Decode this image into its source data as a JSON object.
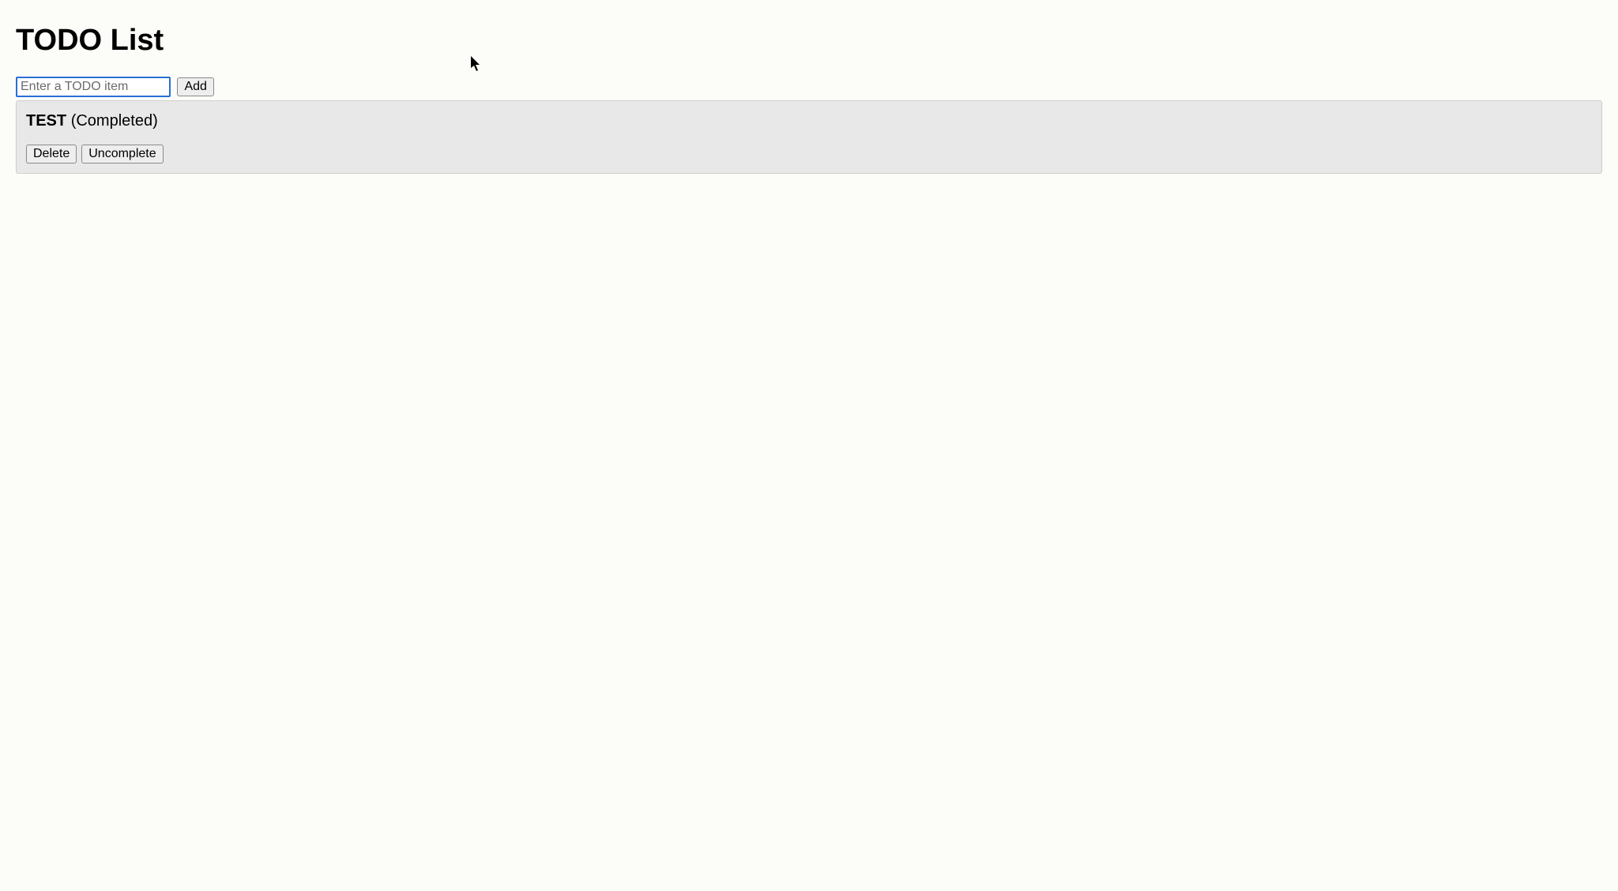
{
  "header": {
    "title": "TODO List"
  },
  "input": {
    "placeholder": "Enter a TODO item",
    "value": "",
    "add_label": "Add"
  },
  "todos": [
    {
      "title": "TEST",
      "status_label": "(Completed)",
      "delete_label": "Delete",
      "toggle_label": "Uncomplete"
    }
  ]
}
